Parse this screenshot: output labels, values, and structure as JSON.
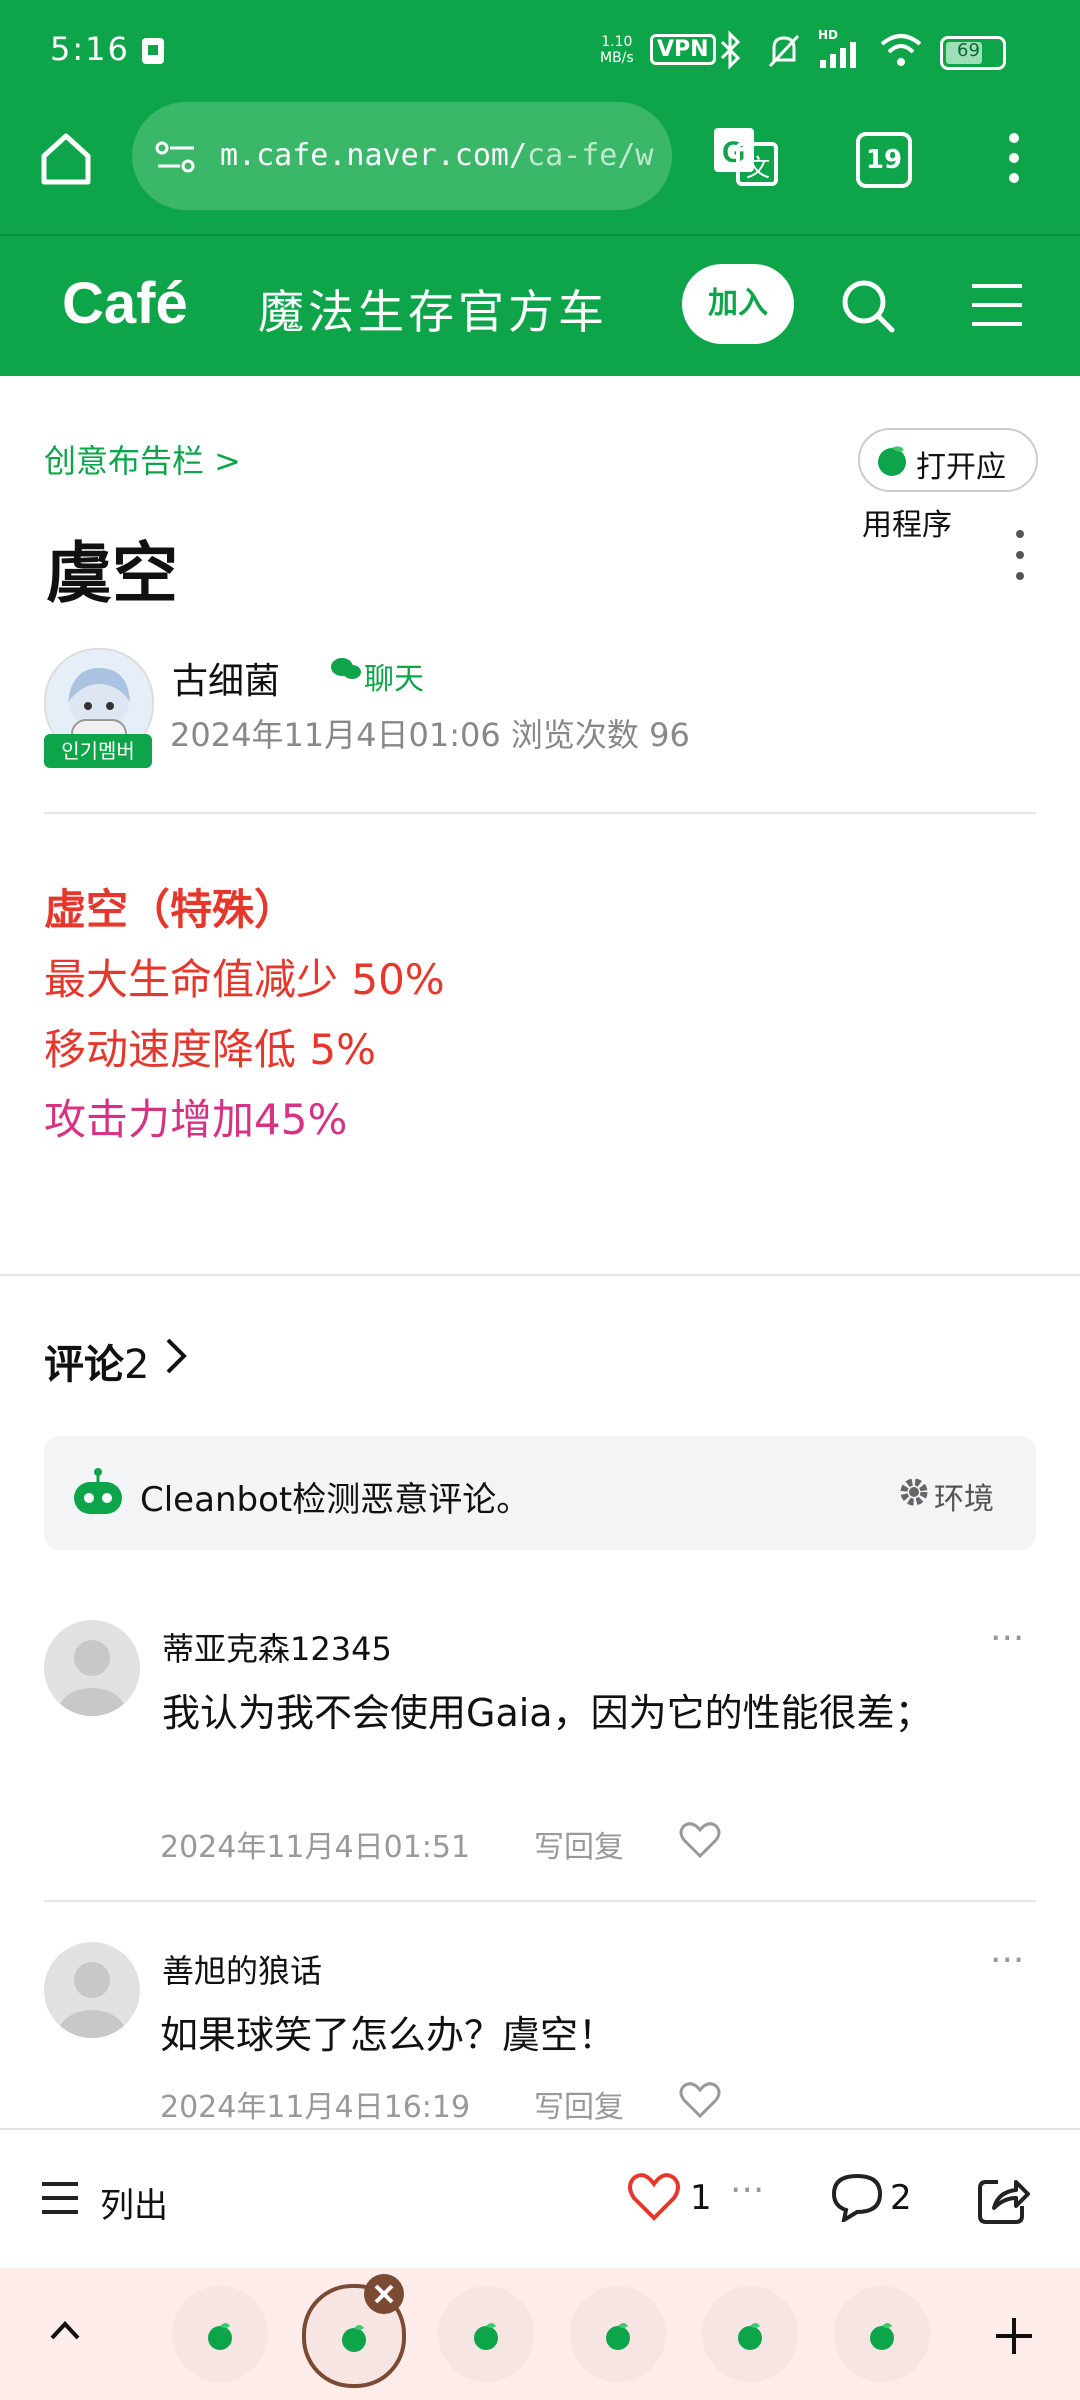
{
  "status_bar": {
    "time": "5:16",
    "net_speed_top": "1.10",
    "net_speed_bottom": "MB/s",
    "vpn": "VPN",
    "hd": "HD",
    "battery": "69",
    "icons": [
      "sim-card-icon",
      "vpn-icon",
      "bluetooth-icon",
      "mute-bell-icon",
      "signal-icon",
      "wifi-icon",
      "battery-icon"
    ]
  },
  "browser": {
    "url_main": "m.cafe.naver.com/",
    "url_dim": "ca-fe/w.",
    "tab_count": "19",
    "icons": [
      "home-icon",
      "site-settings-icon",
      "translate-icon",
      "tabs-icon",
      "menu-icon"
    ]
  },
  "cafe_header": {
    "logo": "Café",
    "cafe_name": "魔法生存官方车",
    "join_label": "加入"
  },
  "article": {
    "breadcrumb": "创意布告栏 >",
    "open_app_line1": "打开应",
    "open_app_line2": "用程序",
    "title": "虞空",
    "author": "古细菌",
    "chat_label": "聊天",
    "badge": "인기멤버",
    "meta": "2024年11月4日01:06  浏览次数 96",
    "content": [
      {
        "text": "虚空（特殊）",
        "style": "red-bold"
      },
      {
        "text": "最大生命值减少 50%",
        "style": "red"
      },
      {
        "text": "移动速度降低 5%",
        "style": "red"
      },
      {
        "text": "攻击力增加45%",
        "style": "pink"
      }
    ]
  },
  "comments": {
    "title": "评论",
    "count": "2",
    "cleanbot_text": "Cleanbot检测恶意评论。",
    "cleanbot_settings": "环境",
    "reply_label": "写回复",
    "items": [
      {
        "name": "蒂亚克森12345",
        "text": "我认为我不会使用Gaia，因为它的性能很差；",
        "time": "2024年11月4日01:51"
      },
      {
        "name": "善旭的狼话",
        "text": "如果球笑了怎么办？虞空！",
        "time": "2024年11月4日16:19"
      }
    ]
  },
  "action_bar": {
    "list_label": "列出",
    "like_count": "1",
    "comment_count": "2"
  },
  "colors": {
    "brand_green": "#0ea44a",
    "content_red": "#e5372b",
    "content_pink": "#d63384",
    "heart_red": "#e5372b"
  }
}
